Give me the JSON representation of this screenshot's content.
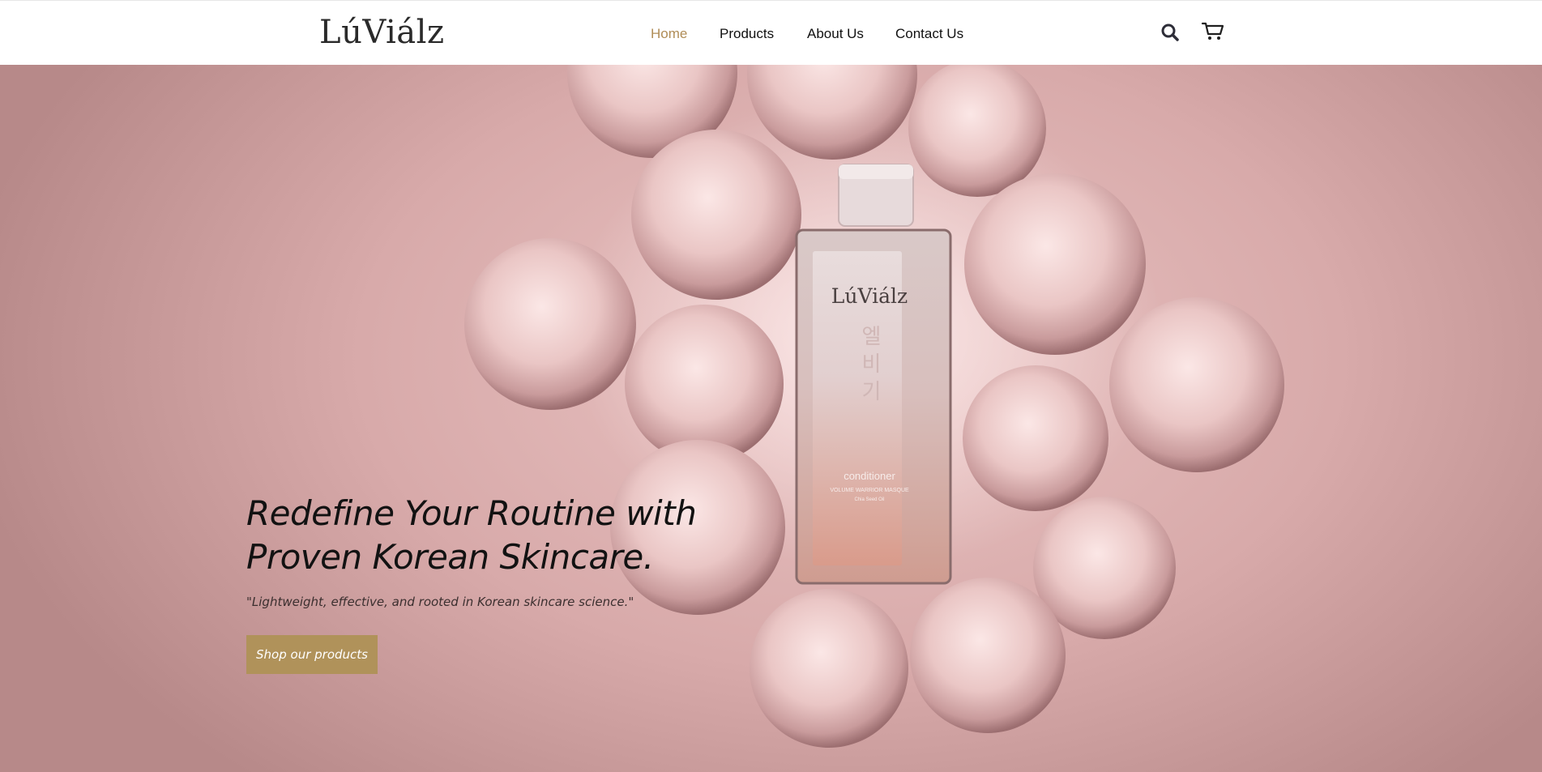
{
  "brand": {
    "logo_text": "LúViálz"
  },
  "nav": {
    "items": [
      {
        "label": "Home",
        "active": true
      },
      {
        "label": "Products",
        "active": false
      },
      {
        "label": "About Us",
        "active": false
      },
      {
        "label": "Contact Us",
        "active": false
      }
    ]
  },
  "header_icons": {
    "search": "search-icon",
    "cart": "cart-icon"
  },
  "hero": {
    "headline": "Redefine Your Routine with Proven Korean Skincare.",
    "tagline": "\"Lightweight, effective, and rooted in Korean skincare science.\"",
    "cta_label": "Shop our products",
    "product_bottle": {
      "brand": "LúViálz",
      "korean_text": "엘비기",
      "product_name": "conditioner",
      "subtitle": "VOLUME WARRIOR MASQUE",
      "ingredient": "Chia Seed Oil"
    }
  },
  "colors": {
    "accent": "#b08d57",
    "cta_background": "#b0925a",
    "hero_pink": "#d8aaaa",
    "text_dark": "#121212"
  }
}
